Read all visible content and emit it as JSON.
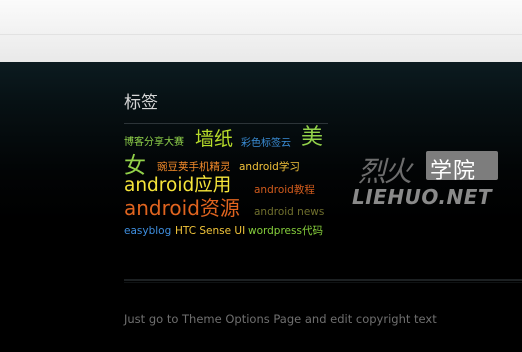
{
  "tags_widget": {
    "title": "标签",
    "tags": [
      {
        "label": "博客分享大赛",
        "color": "#8fd14a"
      },
      {
        "label": "墙纸",
        "color": "#b7dc2a"
      },
      {
        "label": "彩色标签云",
        "color": "#3b8fd9"
      },
      {
        "label": "美女",
        "color": "#93d24a"
      },
      {
        "label": "豌豆荚手机精灵",
        "color": "#f28a2a"
      },
      {
        "label": "android学习",
        "color": "#f2c23a"
      },
      {
        "label": "android应用",
        "color": "#f6e53a"
      },
      {
        "label": "android教程",
        "color": "#cf5a1c"
      },
      {
        "label": "android资源",
        "color": "#e0641f"
      },
      {
        "label": "android news",
        "color": "#6f6f2d"
      },
      {
        "label": "easyblog",
        "color": "#3f8fe0"
      },
      {
        "label": "HTC Sense UI",
        "color": "#f2c53a"
      },
      {
        "label": "wordpress代码",
        "color": "#86cf3c"
      }
    ]
  },
  "footer": {
    "text": "Just go to Theme Options Page and edit copyright text"
  },
  "watermark": {
    "brand_cn": "烈火",
    "brand_cn_box": "学院",
    "brand_en": "LIEHUO.NET"
  },
  "colors": {
    "page_background": "#000000",
    "header_band": "#f1f1f1",
    "title_text": "#d6d6d6",
    "footer_text": "#6f6f6f"
  }
}
